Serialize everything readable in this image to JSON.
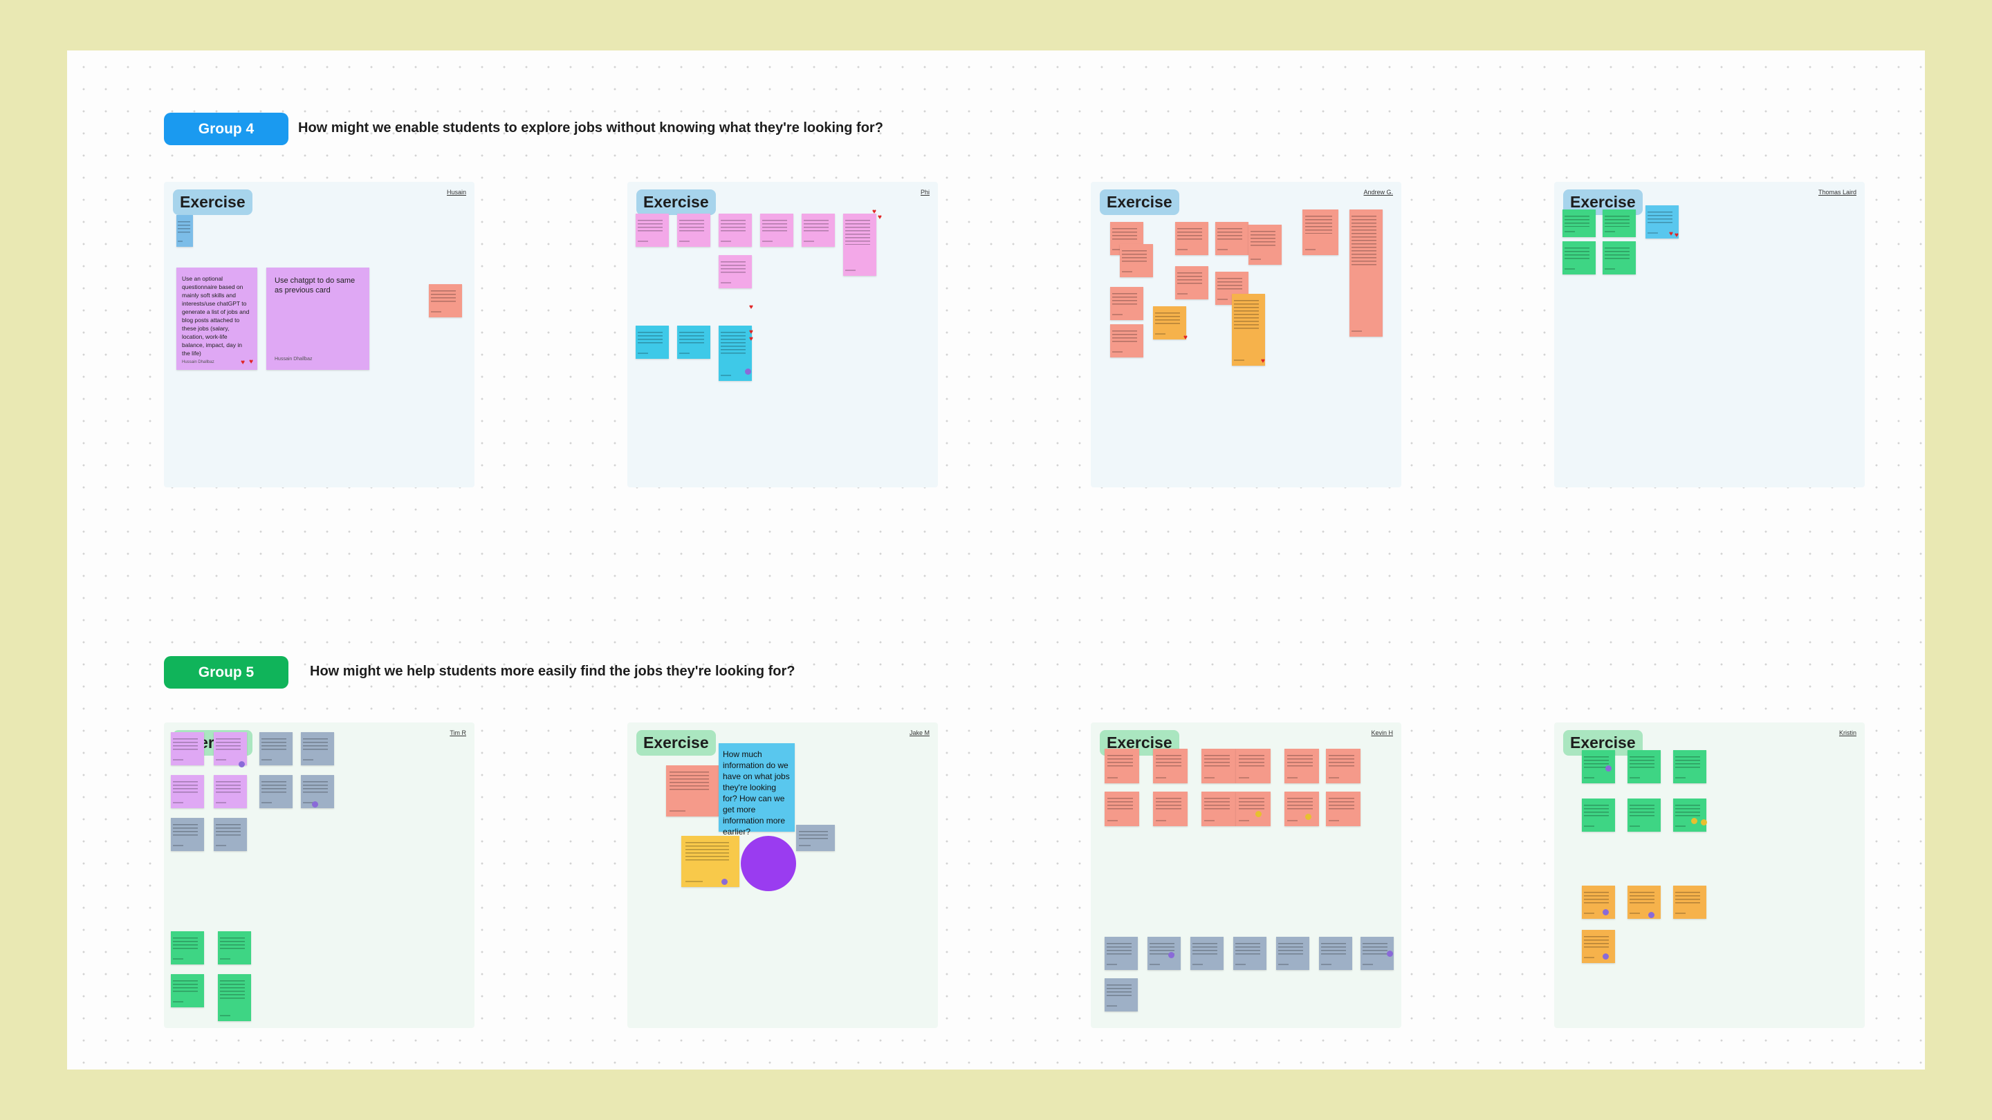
{
  "groups": [
    {
      "label": "Group 4",
      "color": "#1a9af0",
      "question": "How might we enable students to explore jobs without knowing what they're looking for?",
      "sections": [
        {
          "author": "Husain",
          "title": "Exercise",
          "notes": [
            "Use an optional questionnaire based on mainly soft skills and interests/use chatGPT to generate a list of jobs and blog posts attached to these jobs (salary, location, work-life balance, impact, day in the life)",
            "Use chatgpt to do same as previous card"
          ],
          "note_authors": [
            "Hussain Dhallbaz",
            "Hussain Dhallbaz"
          ]
        },
        {
          "author": "Phi",
          "title": "Exercise"
        },
        {
          "author": "Andrew G.",
          "title": "Exercise"
        },
        {
          "author": "Thomas Laird",
          "title": "Exercise"
        }
      ]
    },
    {
      "label": "Group 5",
      "color": "#10b45a",
      "question": "How might we help students more easily find the jobs they're looking for?",
      "sections": [
        {
          "author": "Tim R",
          "title": "Exercise"
        },
        {
          "author": "Jake M",
          "title": "Exercise",
          "notes": [
            "How much information do we have on what jobs they're looking for? How can we get more information more earlier?"
          ]
        },
        {
          "author": "Kevin H",
          "title": "Exercise"
        },
        {
          "author": "Kristin",
          "title": "Exercise"
        }
      ]
    }
  ]
}
